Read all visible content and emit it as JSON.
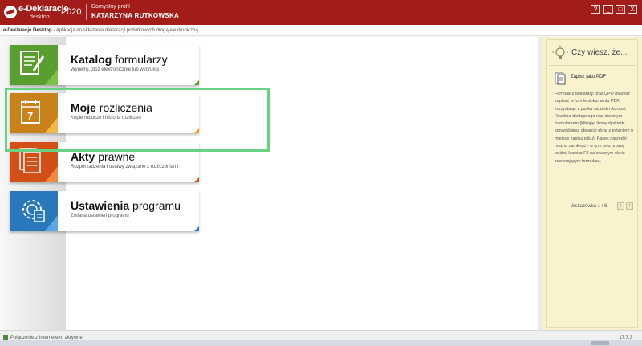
{
  "app": {
    "logo_text": "e-Deklaracje",
    "logo_sub": "desktop",
    "year": "2020",
    "profile_label": "Domyślny profil",
    "profile_name": "KATARZYNA RUTKOWSKA",
    "window_buttons": [
      "?",
      "_",
      "□",
      "X"
    ]
  },
  "breadcrumb": {
    "app_name": "e-Deklaracje Desktop",
    "text": "- Aplikacja do składania deklaracji podatkowych drogą elektroniczną"
  },
  "tiles": [
    {
      "title_bold": "Katalog",
      "title_rest": " formularzy",
      "subtitle": "Wypełnij, złóż elektronicznie lub wydrukuj",
      "icon": "form-edit-icon",
      "color": "#5a9e2f",
      "corner_color": "#5a9e2f"
    },
    {
      "title_bold": "Moje",
      "title_rest": " rozliczenia",
      "subtitle": "Kopie robocze i historia rozliczeń",
      "icon": "calendar-icon",
      "color": "#d08a18",
      "corner_color": "#e6a21e"
    },
    {
      "title_bold": "Akty",
      "title_rest": " prawne",
      "subtitle": "Rozporządzenia i ustawy związane z rozliczeniami",
      "icon": "documents-icon",
      "color": "#d8541c",
      "corner_color": "#d8541c"
    },
    {
      "title_bold": "Ustawienia",
      "title_rest": " programu",
      "subtitle": "Zmiana ustawień programu",
      "icon": "settings-gear-icon",
      "color": "#2b79bd",
      "corner_color": "#2b79bd"
    }
  ],
  "side_panel": {
    "title": "Czy wiesz, że...",
    "icon": "lightbulb-icon",
    "tip_title": "Zapisz jako PDF",
    "tip_body": "Formularz deklaracji oraz UPO możesz zapisać w formie dokumentu PDF, korzystając z paska narzędzi Acrobat Readera dostępnego nad otwartym formularzem (klikając ikonę dyskietki spowodujesz otwarcie okna z pytaniem o miejsce zapisu pliku). Pasek narzędzi można zamknąć - w tym celu proszę wciśnij klawisz F8 na otwartym oknie zawierającym formularz.",
    "hint_counter": "Wskazówka 1 / 6"
  },
  "status": {
    "text": "Połączenie z Internetem: aktywne",
    "version": "17.7.3"
  }
}
